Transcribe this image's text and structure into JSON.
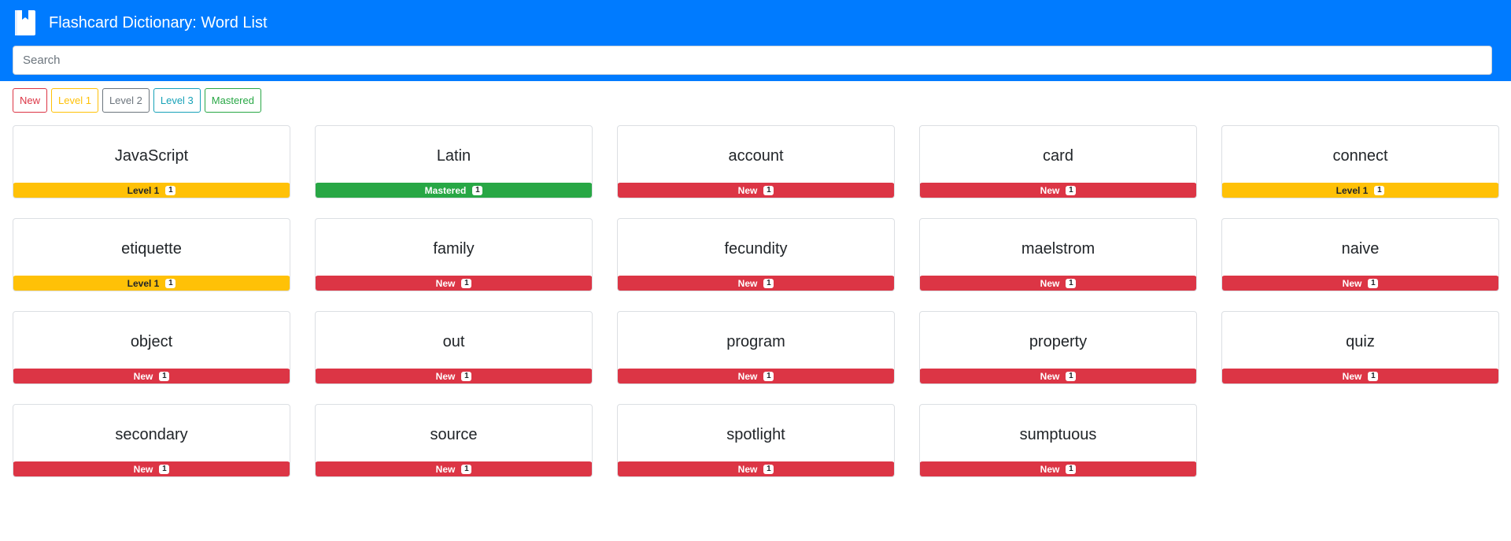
{
  "header": {
    "title": "Flashcard Dictionary: Word List",
    "icon": "book-icon",
    "bg_color": "#007bff"
  },
  "search": {
    "placeholder": "Search",
    "value": ""
  },
  "filters": [
    {
      "label": "New",
      "color": "#dc3545"
    },
    {
      "label": "Level 1",
      "color": "#ffc107"
    },
    {
      "label": "Level 2",
      "color": "#6c757d"
    },
    {
      "label": "Level 3",
      "color": "#17a2b8"
    },
    {
      "label": "Mastered",
      "color": "#28a745"
    }
  ],
  "status_colors": {
    "New": {
      "bg": "#dc3545",
      "fg": "#ffffff"
    },
    "Level 1": {
      "bg": "#ffc107",
      "fg": "#212529"
    },
    "Mastered": {
      "bg": "#28a745",
      "fg": "#ffffff"
    }
  },
  "words": [
    {
      "word": "JavaScript",
      "status": "Level 1",
      "count": "1"
    },
    {
      "word": "Latin",
      "status": "Mastered",
      "count": "1"
    },
    {
      "word": "account",
      "status": "New",
      "count": "1"
    },
    {
      "word": "card",
      "status": "New",
      "count": "1"
    },
    {
      "word": "connect",
      "status": "Level 1",
      "count": "1"
    },
    {
      "word": "etiquette",
      "status": "Level 1",
      "count": "1"
    },
    {
      "word": "family",
      "status": "New",
      "count": "1"
    },
    {
      "word": "fecundity",
      "status": "New",
      "count": "1"
    },
    {
      "word": "maelstrom",
      "status": "New",
      "count": "1"
    },
    {
      "word": "naive",
      "status": "New",
      "count": "1"
    },
    {
      "word": "object",
      "status": "New",
      "count": "1"
    },
    {
      "word": "out",
      "status": "New",
      "count": "1"
    },
    {
      "word": "program",
      "status": "New",
      "count": "1"
    },
    {
      "word": "property",
      "status": "New",
      "count": "1"
    },
    {
      "word": "quiz",
      "status": "New",
      "count": "1"
    },
    {
      "word": "secondary",
      "status": "New",
      "count": "1"
    },
    {
      "word": "source",
      "status": "New",
      "count": "1"
    },
    {
      "word": "spotlight",
      "status": "New",
      "count": "1"
    },
    {
      "word": "sumptuous",
      "status": "New",
      "count": "1"
    }
  ]
}
